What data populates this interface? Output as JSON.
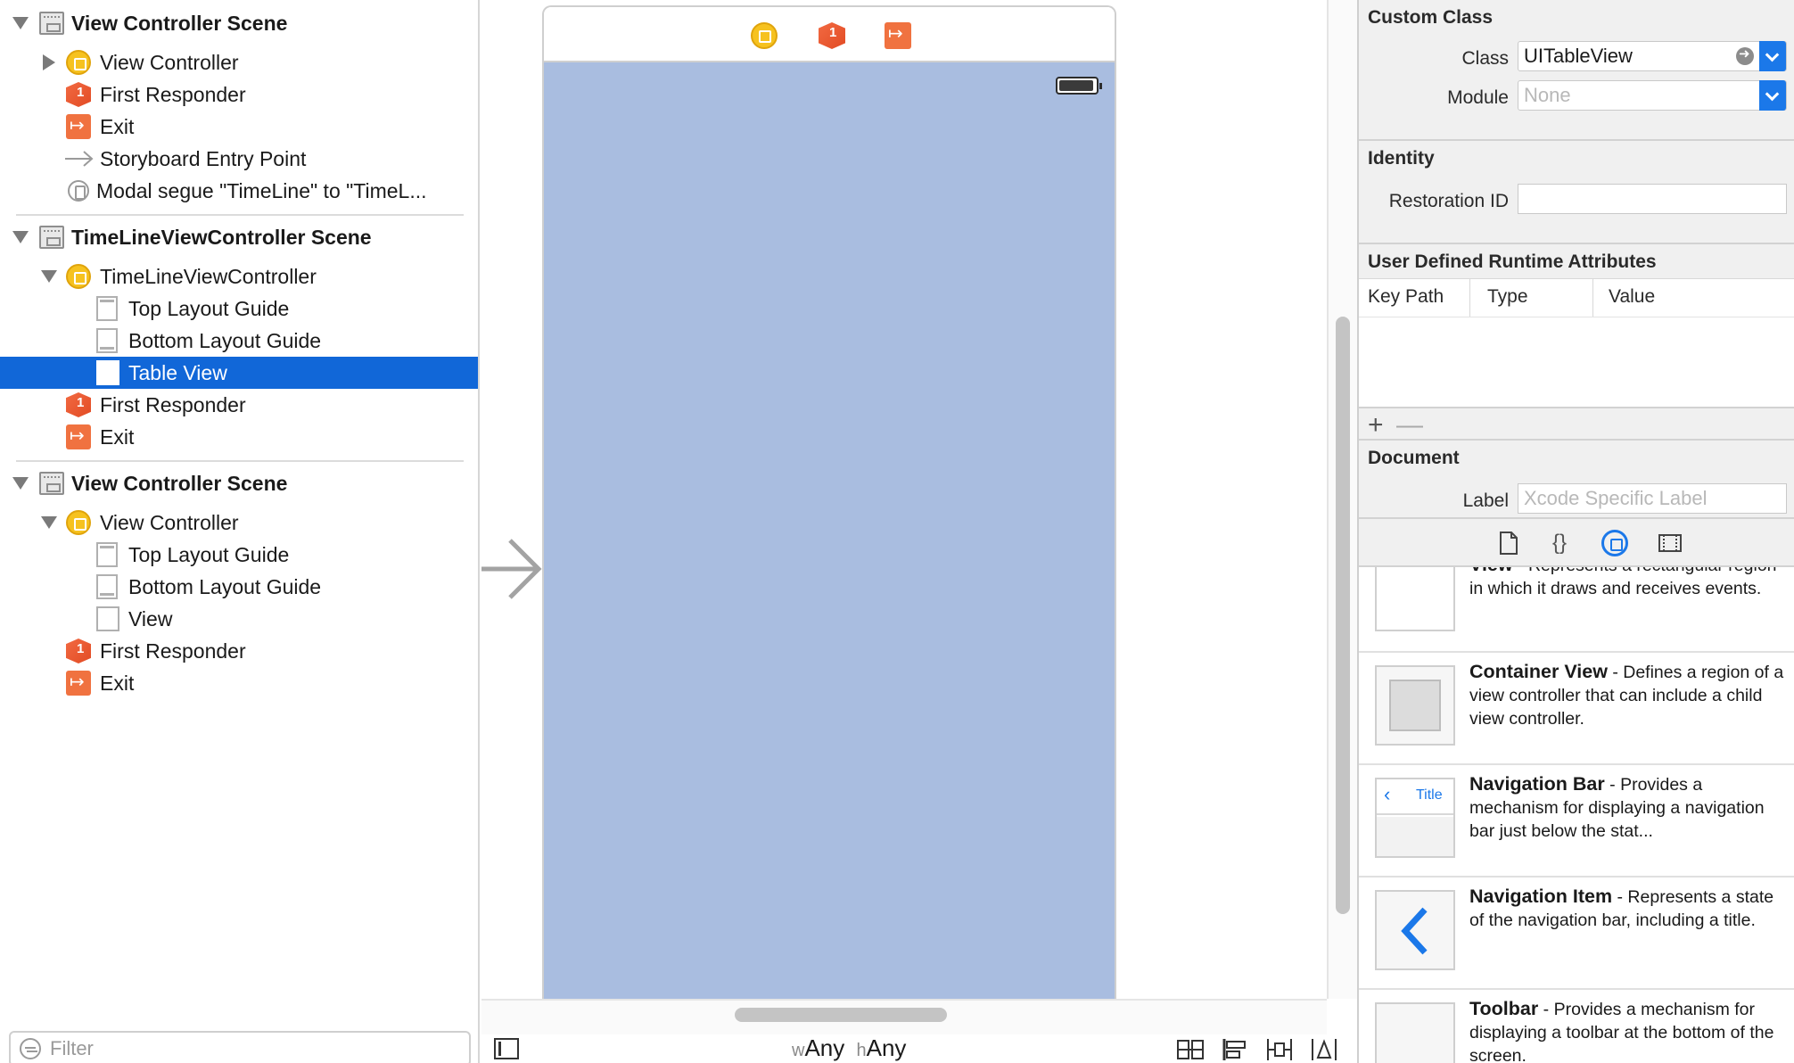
{
  "outline": {
    "scenes": [
      {
        "title": "View Controller Scene",
        "items": [
          {
            "label": "View Controller",
            "icon": "view-controller-icon"
          },
          {
            "label": "First Responder",
            "icon": "first-responder-icon"
          },
          {
            "label": "Exit",
            "icon": "exit-icon"
          },
          {
            "label": "Storyboard Entry Point",
            "icon": "entry-point-arrow-icon"
          },
          {
            "label": "Modal segue \"TimeLine\" to \"TimeL...",
            "icon": "segue-icon"
          }
        ]
      },
      {
        "title": "TimeLineViewController Scene",
        "items": [
          {
            "label": "TimeLineViewController",
            "icon": "view-controller-icon"
          },
          {
            "label": "Top Layout Guide",
            "icon": "top-layout-guide-icon"
          },
          {
            "label": "Bottom Layout Guide",
            "icon": "bottom-layout-guide-icon"
          },
          {
            "label": "Table View",
            "icon": "table-view-icon"
          },
          {
            "label": "First Responder",
            "icon": "first-responder-icon"
          },
          {
            "label": "Exit",
            "icon": "exit-icon"
          }
        ]
      },
      {
        "title": "View Controller Scene",
        "items": [
          {
            "label": "View Controller",
            "icon": "view-controller-icon"
          },
          {
            "label": "Top Layout Guide",
            "icon": "top-layout-guide-icon"
          },
          {
            "label": "Bottom Layout Guide",
            "icon": "bottom-layout-guide-icon"
          },
          {
            "label": "View",
            "icon": "view-icon"
          },
          {
            "label": "First Responder",
            "icon": "first-responder-icon"
          },
          {
            "label": "Exit",
            "icon": "exit-icon"
          }
        ]
      }
    ],
    "filter_placeholder": "Filter"
  },
  "canvas": {
    "size_class": {
      "w_prefix": "w",
      "w_value": "Any",
      "h_prefix": "h",
      "h_value": "Any"
    },
    "scene_background": "#a9bde0"
  },
  "inspector": {
    "custom_class": {
      "title": "Custom Class",
      "class_label": "Class",
      "class_value": "UITableView",
      "module_label": "Module",
      "module_placeholder": "None"
    },
    "identity": {
      "title": "Identity",
      "restoration_label": "Restoration ID",
      "restoration_value": ""
    },
    "runtime_attributes": {
      "title": "User Defined Runtime Attributes",
      "columns": [
        "Key Path",
        "Type",
        "Value"
      ],
      "add": "+",
      "remove": "—"
    },
    "document": {
      "title": "Document",
      "label_label": "Label",
      "label_placeholder": "Xcode Specific Label"
    },
    "tabs": [
      "file-template-icon",
      "code-snippet-icon",
      "object-library-icon",
      "media-library-icon"
    ],
    "library": [
      {
        "name": "View",
        "desc": " - Represents a rectangular region in which it draws and receives events."
      },
      {
        "name": "Container View",
        "desc": " - Defines a region of a view controller that can include a child view controller."
      },
      {
        "name": "Navigation Bar",
        "desc": " - Provides a mechanism for displaying a navigation bar just below the stat...",
        "thumb_text": "Title"
      },
      {
        "name": "Navigation Item",
        "desc": " - Represents a state of the navigation bar, including a title."
      },
      {
        "name": "Toolbar",
        "desc": " - Provides a mechanism for displaying a toolbar at the bottom of the screen."
      }
    ]
  },
  "colors": {
    "selection": "#1167d8",
    "accent": "#1b78e9",
    "view_controller": "#f6c21f",
    "first_responder": "#e24b24"
  }
}
